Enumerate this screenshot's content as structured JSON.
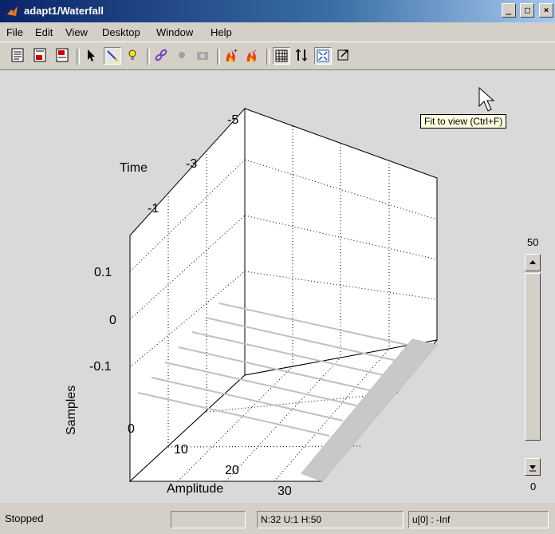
{
  "window": {
    "title": "adapt1/Waterfall",
    "controls": [
      "_",
      "□",
      "×"
    ]
  },
  "menubar": {
    "items": [
      "File",
      "Edit",
      "View",
      "Desktop",
      "Window",
      "Help"
    ]
  },
  "toolbar": {
    "buttons": [
      {
        "icon": "parameters-icon"
      },
      {
        "icon": "export-icon"
      },
      {
        "icon": "history-icon"
      },
      {
        "icon": "select-arrow-icon"
      },
      {
        "icon": "zoom-rotate-icon",
        "pressed": true
      },
      {
        "icon": "light-bulb-icon"
      },
      {
        "icon": "link-icon"
      },
      {
        "icon": "record-dot-icon"
      },
      {
        "icon": "camera-icon"
      },
      {
        "icon": "flame-plus-icon"
      },
      {
        "icon": "flame-minus-icon"
      },
      {
        "icon": "grid-icon",
        "pressed": true
      },
      {
        "icon": "axis-limits-icon"
      },
      {
        "icon": "fit-to-view-icon",
        "pressed": true
      },
      {
        "icon": "resize-icon"
      }
    ],
    "tooltip": "Fit to view (Ctrl+F)"
  },
  "plot": {
    "labels": {
      "time": "Time",
      "samples": "Samples",
      "amplitude": "Amplitude"
    },
    "time_ticks": [
      "-5",
      "-3",
      "-1"
    ],
    "sample_ticks": [
      "0.1",
      "0",
      "-0.1"
    ],
    "amplitude_ticks": [
      "0",
      "10",
      "20",
      "30"
    ]
  },
  "history_slider": {
    "max_label": "50",
    "min_label": "0",
    "position": 1.0
  },
  "status": {
    "state": "Stopped",
    "field_empty": "",
    "info": "N:32 U:1 H:50",
    "value": "u[0] : -Inf"
  },
  "colors": {
    "title_start": "#0a246a",
    "title_end": "#a6caf0",
    "plot_bg": "#ffffff",
    "waterfall_line": "#c0c0c0"
  }
}
